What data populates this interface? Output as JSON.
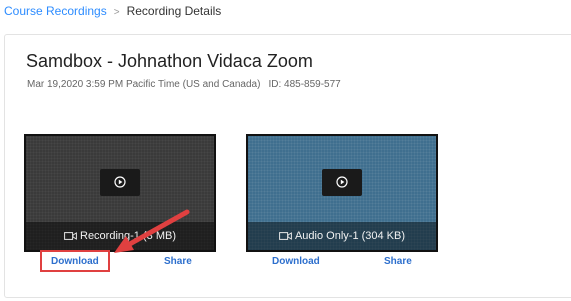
{
  "breadcrumb": {
    "parent": "Course Recordings",
    "separator": ">",
    "current": "Recording Details"
  },
  "recording": {
    "title": "Samdbox - Johnathon Vidaca Zoom",
    "datetime": "Mar 19,2020 3:59 PM Pacific Time (US and Canada)",
    "id_text": "ID: 485-859-577"
  },
  "files": [
    {
      "caption": "Recording-1 (3 MB)",
      "icon": "video-icon",
      "download_label": "Download",
      "share_label": "Share"
    },
    {
      "caption": "Audio Only-1 (304 KB)",
      "icon": "video-icon",
      "download_label": "Download",
      "share_label": "Share"
    }
  ],
  "colors": {
    "link": "#2d8cff",
    "action": "#2d6fcd",
    "annotation": "#e04040"
  }
}
